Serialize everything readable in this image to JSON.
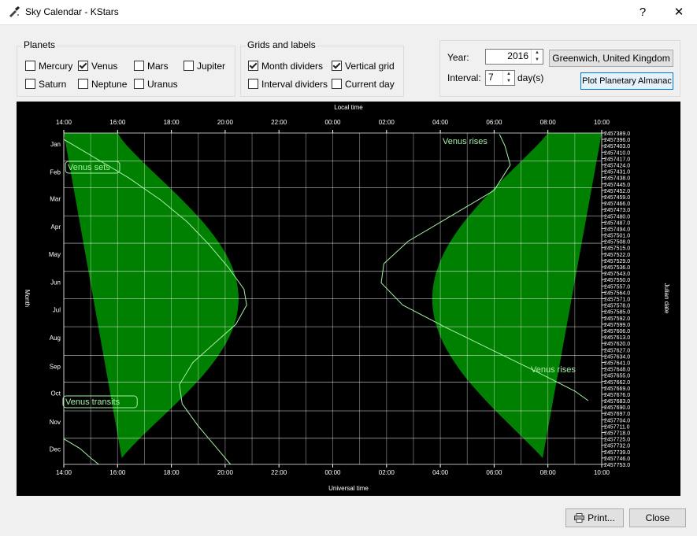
{
  "window": {
    "title": "Sky Calendar - KStars",
    "help_label": "?",
    "close_label": "✕"
  },
  "planets": {
    "title": "Planets",
    "items": [
      {
        "label": "Mercury",
        "checked": false
      },
      {
        "label": "Venus",
        "checked": true
      },
      {
        "label": "Mars",
        "checked": false
      },
      {
        "label": "Jupiter",
        "checked": false
      },
      {
        "label": "Saturn",
        "checked": false
      },
      {
        "label": "Neptune",
        "checked": false
      },
      {
        "label": "Uranus",
        "checked": false
      }
    ]
  },
  "grids": {
    "title": "Grids and labels",
    "items": [
      {
        "label": "Month dividers",
        "checked": true
      },
      {
        "label": "Vertical grid",
        "checked": true
      },
      {
        "label": "Interval dividers",
        "checked": false
      },
      {
        "label": "Current day",
        "checked": false
      }
    ]
  },
  "controls": {
    "year_label": "Year:",
    "year_value": "2016",
    "interval_label": "Interval:",
    "interval_value": "7",
    "interval_unit": "day(s)",
    "location_button": "Greenwich, United Kingdom",
    "plot_button": "Plot Planetary Almanac"
  },
  "plot": {
    "top_axis_title": "Local time",
    "bottom_axis_title": "Universal time",
    "left_axis_title": "Month",
    "right_axis_title": "Julian date",
    "hour_ticks": [
      "14:00",
      "16:00",
      "18:00",
      "20:00",
      "22:00",
      "00:00",
      "02:00",
      "04:00",
      "06:00",
      "08:00",
      "10:00"
    ],
    "months": [
      "Jan",
      "Feb",
      "Mar",
      "Apr",
      "May",
      "Jun",
      "Jul",
      "Aug",
      "Sep",
      "Oct",
      "Nov",
      "Dec"
    ],
    "julian_start": 2457389,
    "julian_step": 7,
    "julian_count": 53,
    "labels": {
      "venus_sets": "Venus sets",
      "venus_rises_top": "Venus rises",
      "venus_rises_mid": "Venus rises",
      "venus_transits": "Venus transits"
    },
    "colors": {
      "background": "#000000",
      "daylight": "#008000",
      "curve": "#a8f0a8",
      "grid": "#ffffff"
    }
  },
  "footer": {
    "print_button": "Print...",
    "close_button": "Close"
  }
}
